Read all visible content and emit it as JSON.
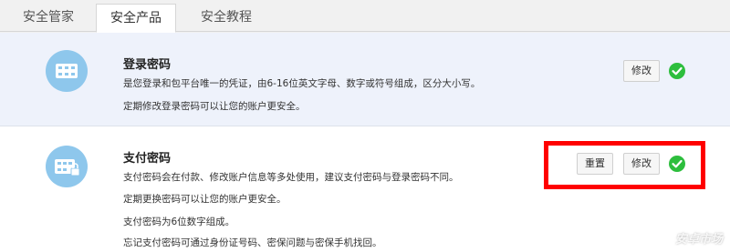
{
  "tabs": [
    {
      "label": "安全管家"
    },
    {
      "label": "安全产品"
    },
    {
      "label": "安全教程"
    }
  ],
  "login_password": {
    "title": "登录密码",
    "desc1": "是您登录和包平台唯一的凭证，由6-16位英文字母、数字或符号组成，区分大小写。",
    "desc2": "定期修改登录密码可以让您的账户更安全。",
    "modify_label": "修改",
    "status_icon": "check-circle-green"
  },
  "pay_password": {
    "title": "支付密码",
    "desc1": "支付密码会在付款、修改账户信息等多处使用，建议支付密码与登录密码不同。",
    "desc2": "定期更换密码可以让您的账户更安全。",
    "desc3": "支付密码为6位数字组成。",
    "desc4": "忘记支付密码可通过身份证号码、密保问题与密保手机找回。",
    "reset_label": "重置",
    "modify_label": "修改",
    "status_icon": "check-circle-green"
  },
  "watermark": "安卓市场",
  "colors": {
    "icon_circle": "#8ec7ec",
    "check_green": "#2dbe3d",
    "highlight_red": "#ff0000",
    "row1_bg": "#eef2fb"
  }
}
